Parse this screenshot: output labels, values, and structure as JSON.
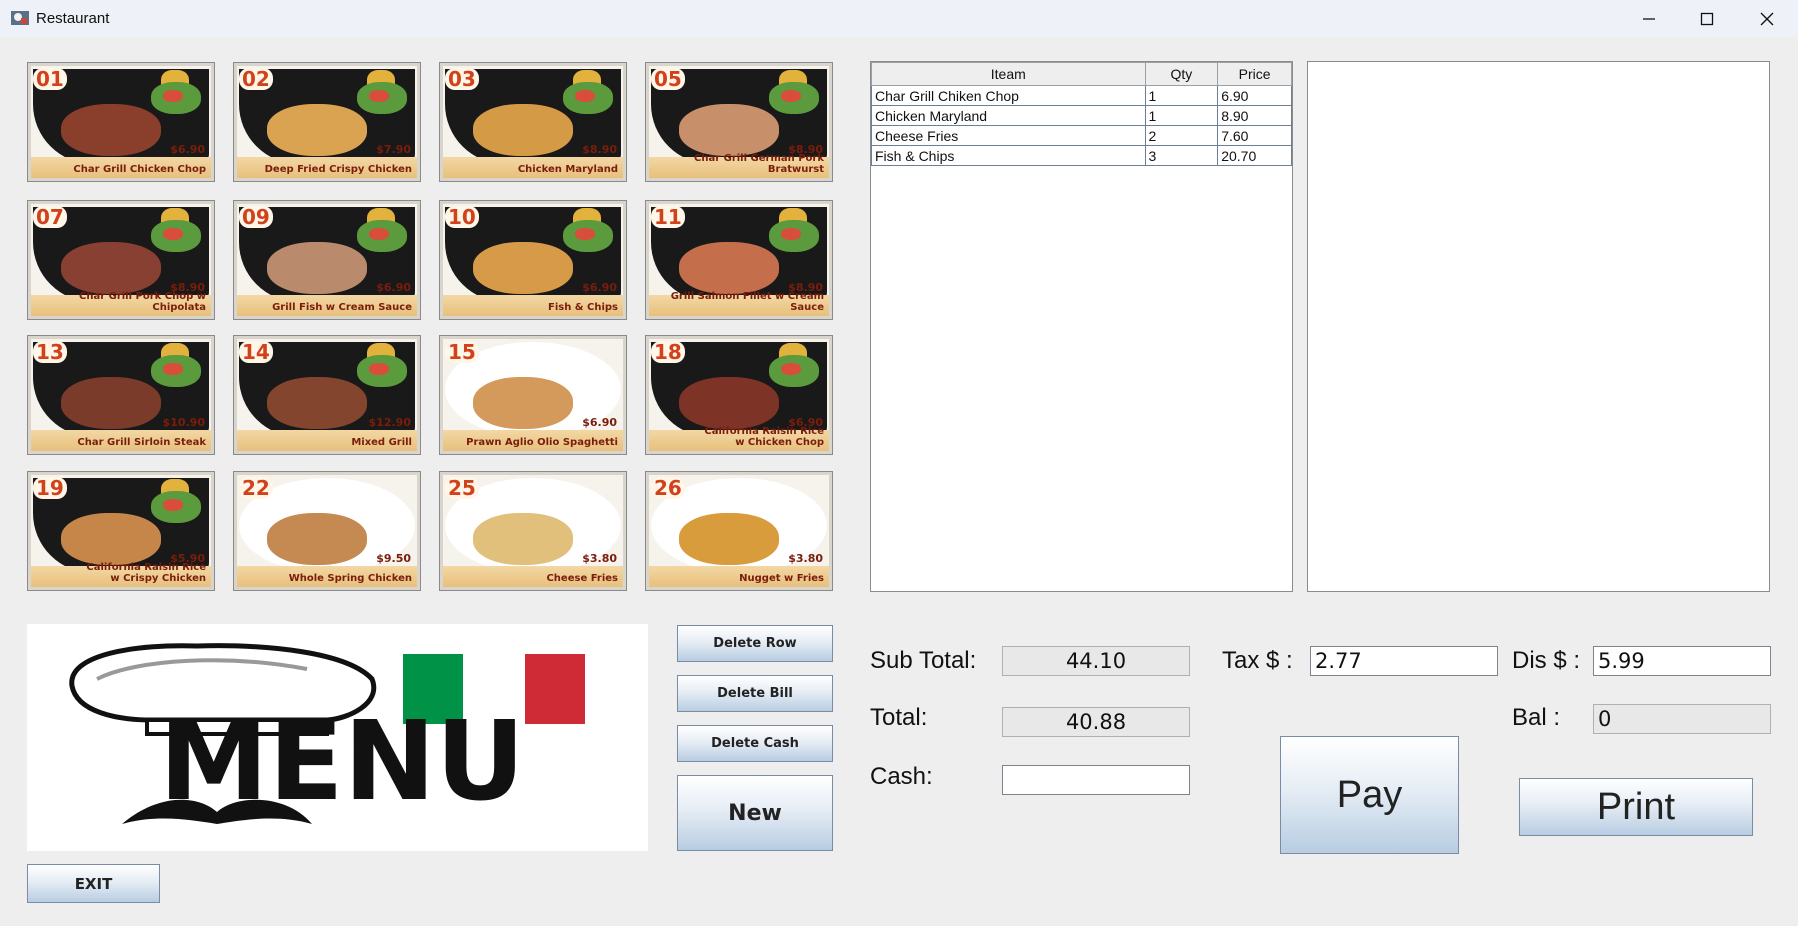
{
  "window": {
    "title": "Restaurant"
  },
  "menu_items": [
    {
      "num": "01",
      "name": "Char Grill Chicken Chop",
      "price": "$6.90"
    },
    {
      "num": "02",
      "name": "Deep Fried Crispy Chicken",
      "price": "$7.90"
    },
    {
      "num": "03",
      "name": "Chicken Maryland",
      "price": "$8.90"
    },
    {
      "num": "05",
      "name": "Char Grill German Pork Bratwurst",
      "price": "$8.90"
    },
    {
      "num": "07",
      "name": "Char Grill Pork Chop w Chipolata",
      "price": "$8.90"
    },
    {
      "num": "09",
      "name": "Grill Fish w Cream Sauce",
      "price": "$6.90"
    },
    {
      "num": "10",
      "name": "Fish & Chips",
      "price": "$6.90"
    },
    {
      "num": "11",
      "name": "Grill Salmon Fillet w Cream Sauce",
      "price": "$8.90"
    },
    {
      "num": "13",
      "name": "Char Grill Sirloin Steak",
      "price": "$10.90"
    },
    {
      "num": "14",
      "name": "Mixed Grill",
      "price": "$12.90"
    },
    {
      "num": "15",
      "name": "Prawn Aglio Olio Spaghetti",
      "price": "$6.90"
    },
    {
      "num": "18",
      "name": "California Raisin Rice\nw Chicken Chop",
      "price": "$6.90"
    },
    {
      "num": "19",
      "name": "California Raisin Rice\nw Crispy Chicken",
      "price": "$5.90"
    },
    {
      "num": "22",
      "name": "Whole Spring Chicken",
      "price": "$9.50"
    },
    {
      "num": "25",
      "name": "Cheese Fries",
      "price": "$3.80"
    },
    {
      "num": "26",
      "name": "Nugget w Fries",
      "price": "$3.80"
    }
  ],
  "order_table": {
    "headers": [
      "Iteam",
      "Qty",
      "Price"
    ],
    "rows": [
      [
        "Char Grill Chiken Chop",
        "1",
        "6.90"
      ],
      [
        "Chicken Maryland",
        "1",
        "8.90"
      ],
      [
        "Cheese Fries",
        "2",
        "7.60"
      ],
      [
        "Fish & Chips",
        "3",
        "20.70"
      ]
    ]
  },
  "menu_image": {
    "text": "MENU"
  },
  "buttons": {
    "delete_row": "Delete Row",
    "delete_bill": "Delete Bill",
    "delete_cash": "Delete Cash",
    "new": "New",
    "exit": "EXIT",
    "pay": "Pay",
    "print": "Print"
  },
  "totals": {
    "sub_total_label": "Sub Total:",
    "sub_total": "44.10",
    "total_label": "Total:",
    "total": "40.88",
    "cash_label": "Cash:",
    "cash": "",
    "tax_label": "Tax $ :",
    "tax": "2.77",
    "dis_label": "Dis $ :",
    "dis": "5.99",
    "bal_label": "Bal :",
    "bal": "0"
  },
  "colors": {
    "accent_price": "#7a1d0c",
    "badge": "#d0411c",
    "flag_green": "#009246",
    "flag_red": "#ce2b37"
  }
}
